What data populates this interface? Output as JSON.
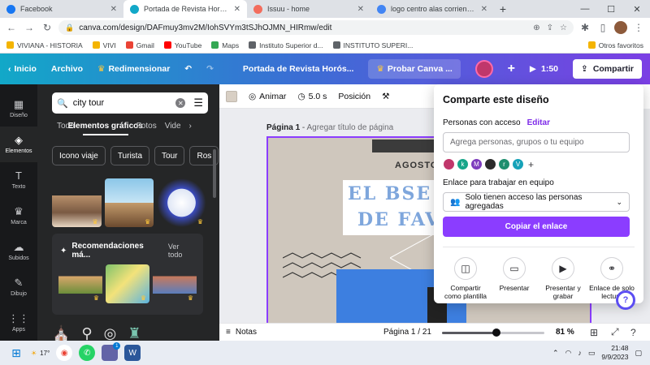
{
  "browser": {
    "tabs": [
      {
        "title": "Facebook",
        "color": "#1877f2",
        "active": false
      },
      {
        "title": "Portada de Revista Horóscopo M",
        "color": "#12a8c8",
        "active": true
      },
      {
        "title": "Issuu - home",
        "color": "#f36d5d",
        "active": false
      },
      {
        "title": "logo centro alas corrientes - Bús",
        "color": "#4285f4",
        "active": false
      }
    ],
    "url": "canva.com/design/DAFmuy3mv2M/IohSVYm3tSJhOJMN_HIRmw/edit",
    "bookmarks": [
      {
        "label": "VIVIANA - HISTORIA",
        "color": "#f4b400"
      },
      {
        "label": "VIVI",
        "color": "#f4b400"
      },
      {
        "label": "Gmail",
        "color": "#ea4335"
      },
      {
        "label": "YouTube",
        "color": "#ff0000"
      },
      {
        "label": "Maps",
        "color": "#34a853"
      },
      {
        "label": "Instituto Superior d...",
        "color": "#5f6368"
      },
      {
        "label": "INSTITUTO SUPERI...",
        "color": "#5f6368"
      }
    ],
    "other_bookmarks": "Otros favoritos"
  },
  "header": {
    "home": "Inicio",
    "file": "Archivo",
    "resize": "Redimensionar",
    "doc_title": "Portada de Revista Horós...",
    "try_pro": "Probar Canva ...",
    "timer": "1:50",
    "share": "Compartir"
  },
  "rail": [
    {
      "label": "Diseño",
      "icon": "▦",
      "active": false
    },
    {
      "label": "Elementos",
      "icon": "◈",
      "active": true
    },
    {
      "label": "Texto",
      "icon": "T",
      "active": false
    },
    {
      "label": "Marca",
      "icon": "♛",
      "active": false
    },
    {
      "label": "Subidos",
      "icon": "☁",
      "active": false
    },
    {
      "label": "Dibujo",
      "icon": "✎",
      "active": false
    },
    {
      "label": "Apps",
      "icon": "⋮⋮",
      "active": false
    }
  ],
  "panel": {
    "search_value": "city tour",
    "tabs": [
      "Todo",
      "Elementos gráficos",
      "Fotos",
      "Vide"
    ],
    "active_tab": "Elementos gráficos",
    "chips": [
      "Icono viaje",
      "Turista",
      "Tour",
      "Ros"
    ],
    "recs_title": "Recomendaciones má...",
    "recs_see_all": "Ver todo"
  },
  "toolbar": {
    "animate": "Animar",
    "duration": "5.0 s",
    "position": "Posición"
  },
  "canvas": {
    "page_label": "Página 1",
    "page_title_placeholder": "Agregar título de página",
    "month": "AGOSTO",
    "title_line1": "EL BSE",
    "title_line2": "DE FAV"
  },
  "share_panel": {
    "title": "Comparte este diseño",
    "people_label": "Personas con acceso",
    "edit": "Editar",
    "add_placeholder": "Agrega personas, grupos o tu equipo",
    "collaborators": [
      {
        "initial": "",
        "color": "#c0376b"
      },
      {
        "initial": "k",
        "color": "#17a589"
      },
      {
        "initial": "M",
        "color": "#7d3cbd"
      },
      {
        "initial": "",
        "color": "#2b2b2b"
      },
      {
        "initial": "r",
        "color": "#1e8e6e"
      },
      {
        "initial": "V",
        "color": "#16a2b8"
      }
    ],
    "link_label": "Enlace para trabajar en equipo",
    "access_value": "Solo tienen acceso las personas agregadas",
    "copy_button": "Copiar el enlace",
    "actions": [
      {
        "label": "Compartir como plantilla",
        "icon": "◫"
      },
      {
        "label": "Presentar",
        "icon": "▭"
      },
      {
        "label": "Presentar y grabar",
        "icon": "▶"
      },
      {
        "label": "Enlace de solo lectura",
        "icon": "⚭"
      }
    ]
  },
  "bottom": {
    "notes": "Notas",
    "page_counter": "Página 1 / 21",
    "zoom": "81 %",
    "zoom_fraction": 0.53
  },
  "taskbar": {
    "temp": "17°",
    "time": "21:48",
    "date": "9/9/2023",
    "chat_badge": "1"
  }
}
